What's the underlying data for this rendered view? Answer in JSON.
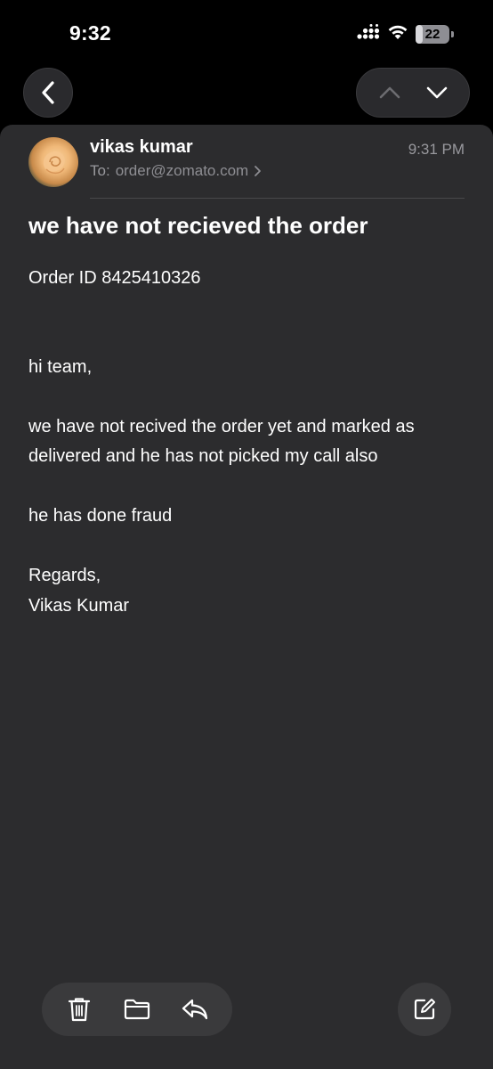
{
  "status_bar": {
    "time": "9:32",
    "battery_level": "22",
    "battery_fraction": 0.22,
    "icons": [
      "signal-icon",
      "wifi-icon",
      "battery-icon"
    ]
  },
  "navigation": {
    "back_icon": "chevron-left-icon",
    "previous_icon": "chevron-up-icon",
    "next_icon": "chevron-down-icon"
  },
  "email": {
    "sender_name": "vikas kumar",
    "to_label": "To:",
    "to_address": "order@zomato.com",
    "time": "9:31 PM",
    "subject": "we have not recieved the order",
    "body": {
      "order_line": "Order ID 8425410326",
      "greeting": "hi team,",
      "paragraph1_line1": "we have not recived the order yet and marked as",
      "paragraph1_line2": "delivered and he has not picked my call also",
      "paragraph2": "he has done fraud",
      "closing": "Regards,",
      "signature": "Vikas Kumar"
    }
  },
  "toolbar": {
    "icons": [
      "trash-icon",
      "folder-icon",
      "reply-icon",
      "compose-icon"
    ]
  },
  "colors": {
    "background": "#000000",
    "card": "#2c2c2e",
    "secondary_text": "#98989d",
    "toolbar": "#3a3a3c"
  }
}
